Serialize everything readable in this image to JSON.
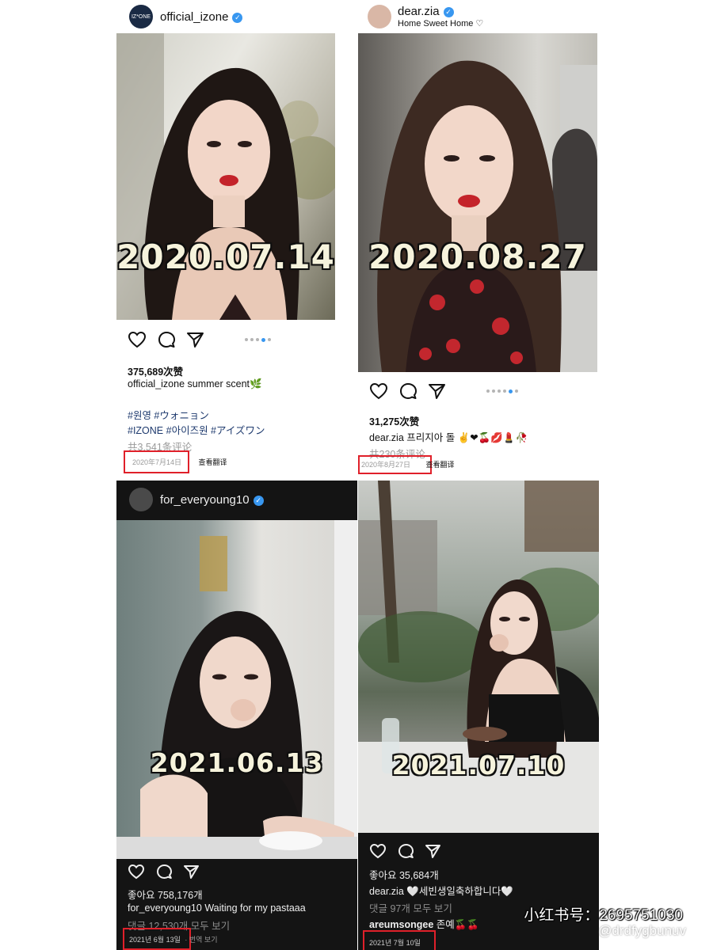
{
  "posts": [
    {
      "username": "official_izone",
      "avatar_text": "IZ*ONE",
      "overlay_date": "2020.07.14",
      "likes": "375,689次赞",
      "caption_user": "official_izone",
      "caption_text": "summer scent🌿",
      "tags_line1": "#원영 #ウォニョン",
      "tags_line2": "#IZONE #아이즈원 #アイズワン",
      "comments": "共3,541条评论",
      "date": "2020年7月14日",
      "translate": "查看翻译"
    },
    {
      "username": "dear.zia",
      "bio": "Home Sweet Home ♡",
      "overlay_date": "2020.08.27",
      "likes": "31,275次赞",
      "caption_user": "dear.zia",
      "caption_text": "프리지아 돌 ✌❤🍒💋💄🥀",
      "comments": "共230条评论",
      "date": "2020年8月27日",
      "translate": "查看翻译"
    },
    {
      "username": "for_everyoung10",
      "overlay_date": "2021.06.13",
      "likes": "좋아요 758,176개",
      "caption_user": "for_everyoung10",
      "caption_text": "Waiting for my pastaaa",
      "comments": "댓글 12,530개 모두 보기",
      "date": "2021년 6월 13일",
      "translate": "· 번역 보기"
    },
    {
      "overlay_date": "2021.07.10",
      "likes": "좋아요 35,684개",
      "caption_user": "dear.zia",
      "caption_text": "🤍세빈생일축하합니다🤍",
      "comments": "댓글 97개 모두 보기",
      "comment_user": "areumsongee",
      "comment_text": "존예🍒🍒",
      "date": "2021년 7월 10일"
    }
  ],
  "watermark": {
    "line1": "小红书号：2695751030",
    "line2": "@drdfygbunuv",
    "logo": "小红书"
  },
  "colors": {
    "verified": "#3897f0",
    "highlight_box": "#e0202a",
    "overlay_text": "#f6f3dc"
  }
}
